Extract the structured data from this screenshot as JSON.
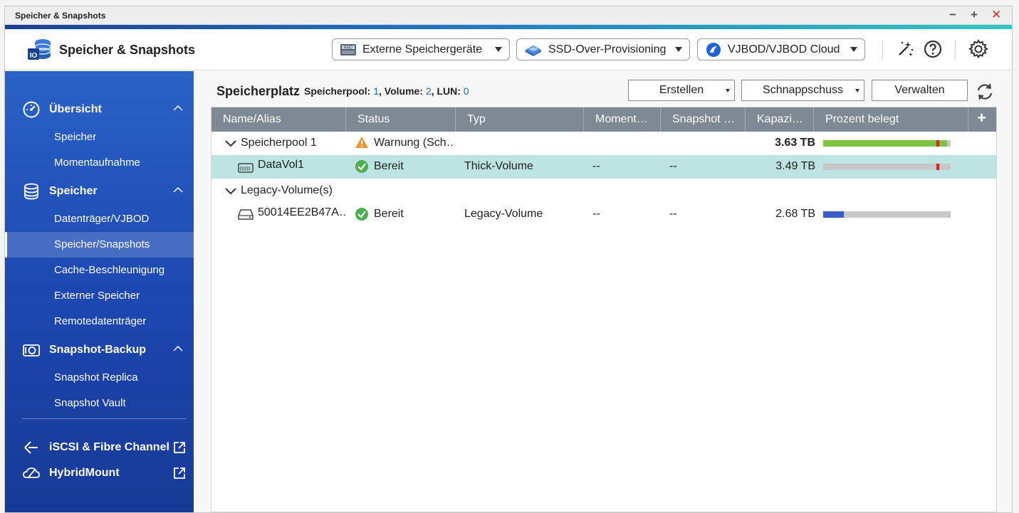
{
  "window": {
    "title": "Speicher & Snapshots",
    "controls": {
      "minimize": "−",
      "maximize": "+",
      "close": "✕"
    }
  },
  "header": {
    "app_title": "Speicher & Snapshots",
    "buttons": [
      {
        "label": "Externe Speichergeräte",
        "icon": "raid-icon"
      },
      {
        "label": "SSD-Over-Provisioning",
        "icon": "ssd-icon"
      },
      {
        "label": "VJBOD/VJBOD Cloud",
        "icon": "vjbod-cloud-icon"
      }
    ],
    "icons": [
      "magic-wand-icon",
      "help-icon",
      "settings-gear-icon"
    ]
  },
  "sidebar": {
    "groups": [
      {
        "label": "Übersicht",
        "icon": "speedometer-icon",
        "items": [
          "Speicher",
          "Momentaufnahme"
        ]
      },
      {
        "label": "Speicher",
        "icon": "database-icon",
        "items": [
          "Datenträger/VJBOD",
          "Speicher/Snapshots",
          "Cache-Beschleunigung",
          "Externer Speicher",
          "Remotedatenträger"
        ]
      },
      {
        "label": "Snapshot-Backup",
        "icon": "camera-icon",
        "items": [
          "Snapshot Replica",
          "Snapshot Vault"
        ]
      }
    ],
    "active_item": "Speicher/Snapshots",
    "links": [
      {
        "label": "iSCSI & Fibre Channel",
        "icon": "iscsi-icon"
      },
      {
        "label": "HybridMount",
        "icon": "hybridmount-cloud-icon"
      }
    ]
  },
  "toolbar": {
    "title": "Speicherplatz",
    "summary": {
      "pool_label": "Speicherpool: ",
      "pool_count": "1",
      "volume_label": ", Volume: ",
      "volume_count": "2",
      "lun_label": ", LUN: ",
      "lun_count": "0"
    },
    "buttons": {
      "create": "Erstellen",
      "snapshot": "Schnappschuss",
      "manage": "Verwalten"
    }
  },
  "table": {
    "columns": [
      "Name/Alias",
      "Status",
      "Typ",
      "Moment…",
      "Snapshot …",
      "Kapazi…",
      "Prozent belegt"
    ],
    "add_column": "+",
    "rows": [
      {
        "name": "Speicherpool 1",
        "kind": "group",
        "status": "Warnung (Sch…",
        "status_icon": "warning-icon",
        "type": "",
        "moment": "",
        "snapshot": "",
        "capacity": "3.63 TB",
        "used_percent": 97,
        "bar_color": "#7dc240"
      },
      {
        "name": "DataVol1",
        "kind": "volume",
        "status": "Bereit",
        "status_icon": "check-circle-icon",
        "type": "Thick-Volume",
        "moment": "--",
        "snapshot": "--",
        "capacity": "3.49 TB",
        "used_percent": 0,
        "bar_color": "#c8c8c8",
        "selected": true
      },
      {
        "name": "Legacy-Volume(s)",
        "kind": "group"
      },
      {
        "name": "50014EE2B47A…",
        "kind": "disk",
        "status": "Bereit",
        "status_icon": "check-circle-icon",
        "type": "Legacy-Volume",
        "moment": "--",
        "snapshot": "--",
        "capacity": "2.68 TB",
        "used_percent": 16,
        "bar_color": "#3b5cc4"
      }
    ]
  },
  "colors": {
    "accent_start": "#1d3f94",
    "accent_end": "#32c7c2",
    "sidebar": "#1d48b2",
    "selected_row": "#bde3e3",
    "warning": "#f0932b",
    "ok": "#4caf50"
  }
}
